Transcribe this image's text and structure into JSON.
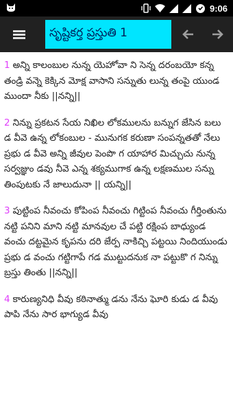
{
  "statusbar": {
    "left_icon": "cat-notification-icon",
    "time": "9:06"
  },
  "appbar": {
    "title": "సృష్టికర్త ప్రస్తుతి 1"
  },
  "verses": [
    {
      "number": "1",
      "text": "అన్ని కాలంబుల నున్న యెహోవా ని సెన్న దరంబయో కన్న తండ్రి వన్నె కెక్కిన మోక్ష వాసాని సన్నుతు లున్న తంపై యుండ ముందా నీకు ||నన్ని||"
    },
    {
      "number": "2",
      "text": "నిన్ను ప్రకటన సేయ నిఖిల లోకములను బన్నుగ జేసిన బలు డ వీవె ఉన్న లోకంబుల - మునుగక కరుణా సంపన్నతతో నేలు ప్రభు డ వీవె అన్ని జీవుల పెంపొ గ యాహార మిచ్చుచు నున్న సర్వజ్ఞుం డవు నీవె ఎన్న శక్యముగాక ఉన్న లక్షణముల సన్ను తింపుటకు నే జాలుదునా || యన్ని||"
    },
    {
      "number": "3",
      "text": "పుట్టింప నీవంచు కోపింప నీవంచు గిట్టింప నీవంచు గీర్తింతును నట్టి పనిని మాని నట్టి మానవుల చే పట్టి రక్షింప బాధ్యుండ వంచు దట్టమైన కృపను దరి జేర్ప నాకిచ్చి పట్టయి నిందియుండు ప్రభు డ వంచు గట్టిగాపే గడ ముట్టుదనుక నా పట్టుకొ గ నిన్ను బ్రస్తు తింతు ||నన్ని||"
    },
    {
      "number": "4",
      "text": "కారుణ్యనిధి వీవు కఠినాత్ము డను నేను ఘోరి కుడు డ వీవు పాపి నేను సార భాగ్యుడ వీవు"
    }
  ]
}
